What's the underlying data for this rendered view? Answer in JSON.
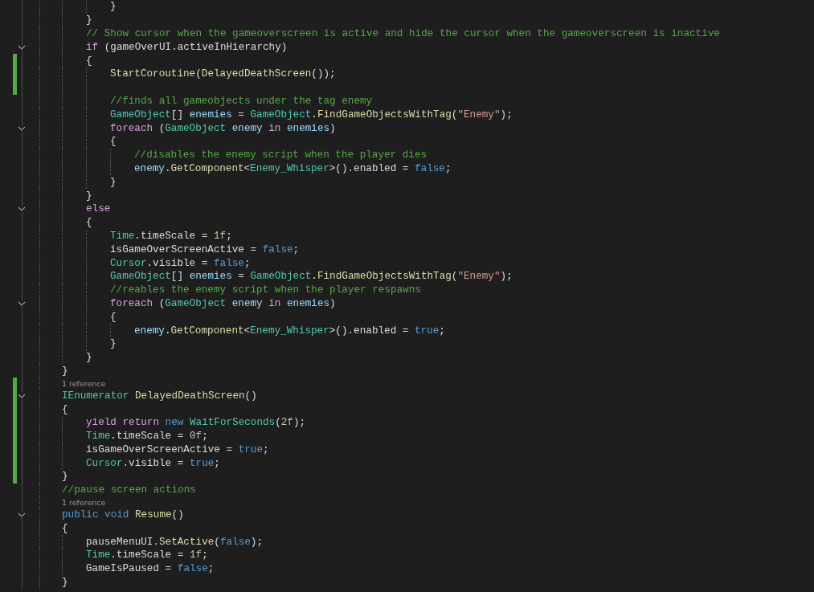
{
  "lines": [
    {
      "children": [
        {
          "children": [
            {
              "kind": "code",
              "tokens": [
                {
                  "text": "}",
                  "kind": "plain"
                }
              ]
            }
          ]
        },
        {
          "kind": "code",
          "tokens": [
            {
              "text": "}",
              "kind": "plain"
            }
          ]
        },
        {
          "kind": "code",
          "tokens": [
            {
              "text": "// Show cursor when the gameoverscreen is active and hide the cursor when the gameoverscreen is inactive",
              "kind": "comment"
            }
          ]
        },
        {
          "kind": "code",
          "foldable": true,
          "tokens": [
            {
              "text": "if",
              "kind": "keyword"
            },
            {
              "text": " (gameOverUI.activeInHierarchy)",
              "kind": "plain"
            }
          ]
        },
        {
          "kind": "code",
          "changed": true,
          "tokens": [
            {
              "text": "{",
              "kind": "plain"
            }
          ],
          "children": [
            {
              "kind": "code",
              "changed": true,
              "tokens": [
                {
                  "text": "StartCoroutine",
                  "kind": "method"
                },
                {
                  "text": "(",
                  "kind": "plain"
                },
                {
                  "text": "DelayedDeathScreen",
                  "kind": "method"
                },
                {
                  "text": "());",
                  "kind": "plain"
                }
              ]
            },
            {
              "kind": "blank",
              "changed": true
            },
            {
              "kind": "code",
              "tokens": [
                {
                  "text": "//finds all gameobjects under the tag enemy",
                  "kind": "comment"
                }
              ]
            },
            {
              "kind": "code",
              "tokens": [
                {
                  "text": "GameObject",
                  "kind": "type"
                },
                {
                  "text": "[] ",
                  "kind": "plain"
                },
                {
                  "text": "enemies",
                  "kind": "variable"
                },
                {
                  "text": " = ",
                  "kind": "plain"
                },
                {
                  "text": "GameObject",
                  "kind": "type"
                },
                {
                  "text": ".",
                  "kind": "plain"
                },
                {
                  "text": "FindGameObjectsWithTag",
                  "kind": "method"
                },
                {
                  "text": "(",
                  "kind": "plain"
                },
                {
                  "text": "\"Enemy\"",
                  "kind": "string"
                },
                {
                  "text": ");",
                  "kind": "plain"
                }
              ]
            },
            {
              "kind": "code",
              "foldable": true,
              "tokens": [
                {
                  "text": "foreach",
                  "kind": "keyword"
                },
                {
                  "text": " (",
                  "kind": "plain"
                },
                {
                  "text": "GameObject",
                  "kind": "type"
                },
                {
                  "text": " enemy ",
                  "kind": "variable"
                },
                {
                  "text": "in",
                  "kind": "keyword"
                },
                {
                  "text": " enemies",
                  "kind": "variable"
                },
                {
                  "text": ")",
                  "kind": "plain"
                }
              ]
            },
            {
              "kind": "code",
              "tokens": [
                {
                  "text": "{",
                  "kind": "plain"
                }
              ],
              "children": [
                {
                  "kind": "code",
                  "tokens": [
                    {
                      "text": "//disables the enemy script when the player dies",
                      "kind": "comment"
                    }
                  ]
                },
                {
                  "kind": "code",
                  "tokens": [
                    {
                      "text": "enemy",
                      "kind": "variable"
                    },
                    {
                      "text": ".",
                      "kind": "plain"
                    },
                    {
                      "text": "GetComponent",
                      "kind": "method"
                    },
                    {
                      "text": "<",
                      "kind": "plain"
                    },
                    {
                      "text": "Enemy_Whisper",
                      "kind": "type"
                    },
                    {
                      "text": ">().enabled = ",
                      "kind": "plain"
                    },
                    {
                      "text": "false",
                      "kind": "literal"
                    },
                    {
                      "text": ";",
                      "kind": "plain"
                    }
                  ]
                }
              ]
            },
            {
              "kind": "code",
              "tokens": [
                {
                  "text": "}",
                  "kind": "plain"
                }
              ]
            }
          ]
        },
        {
          "kind": "code",
          "tokens": [
            {
              "text": "}",
              "kind": "plain"
            }
          ]
        },
        {
          "kind": "code",
          "foldable": true,
          "tokens": [
            {
              "text": "else",
              "kind": "keyword"
            }
          ]
        },
        {
          "kind": "code",
          "tokens": [
            {
              "text": "{",
              "kind": "plain"
            }
          ],
          "children": [
            {
              "kind": "code",
              "tokens": [
                {
                  "text": "Time",
                  "kind": "type"
                },
                {
                  "text": ".timeScale = ",
                  "kind": "plain"
                },
                {
                  "text": "1f",
                  "kind": "number"
                },
                {
                  "text": ";",
                  "kind": "plain"
                }
              ]
            },
            {
              "kind": "code",
              "tokens": [
                {
                  "text": "isGameOverScreenActive = ",
                  "kind": "plain"
                },
                {
                  "text": "false",
                  "kind": "literal"
                },
                {
                  "text": ";",
                  "kind": "plain"
                }
              ]
            },
            {
              "kind": "code",
              "tokens": [
                {
                  "text": "Cursor",
                  "kind": "type"
                },
                {
                  "text": ".visible = ",
                  "kind": "plain"
                },
                {
                  "text": "false",
                  "kind": "literal"
                },
                {
                  "text": ";",
                  "kind": "plain"
                }
              ]
            },
            {
              "kind": "code",
              "tokens": [
                {
                  "text": "GameObject",
                  "kind": "type"
                },
                {
                  "text": "[] ",
                  "kind": "plain"
                },
                {
                  "text": "enemies",
                  "kind": "variable"
                },
                {
                  "text": " = ",
                  "kind": "plain"
                },
                {
                  "text": "GameObject",
                  "kind": "type"
                },
                {
                  "text": ".",
                  "kind": "plain"
                },
                {
                  "text": "FindGameObjectsWithTag",
                  "kind": "method"
                },
                {
                  "text": "(",
                  "kind": "plain"
                },
                {
                  "text": "\"Enemy\"",
                  "kind": "string"
                },
                {
                  "text": ");",
                  "kind": "plain"
                }
              ]
            },
            {
              "kind": "code",
              "tokens": [
                {
                  "text": "//reables the enemy script when the player respawns",
                  "kind": "comment"
                }
              ]
            },
            {
              "kind": "code",
              "foldable": true,
              "tokens": [
                {
                  "text": "foreach",
                  "kind": "keyword"
                },
                {
                  "text": " (",
                  "kind": "plain"
                },
                {
                  "text": "GameObject",
                  "kind": "type"
                },
                {
                  "text": " enemy ",
                  "kind": "variable"
                },
                {
                  "text": "in",
                  "kind": "keyword"
                },
                {
                  "text": " enemies",
                  "kind": "variable"
                },
                {
                  "text": ")",
                  "kind": "plain"
                }
              ]
            },
            {
              "kind": "code",
              "tokens": [
                {
                  "text": "{",
                  "kind": "plain"
                }
              ],
              "children": [
                {
                  "kind": "code",
                  "tokens": [
                    {
                      "text": "enemy",
                      "kind": "variable"
                    },
                    {
                      "text": ".",
                      "kind": "plain"
                    },
                    {
                      "text": "GetComponent",
                      "kind": "method"
                    },
                    {
                      "text": "<",
                      "kind": "plain"
                    },
                    {
                      "text": "Enemy_Whisper",
                      "kind": "type"
                    },
                    {
                      "text": ">().enabled = ",
                      "kind": "plain"
                    },
                    {
                      "text": "true",
                      "kind": "literal"
                    },
                    {
                      "text": ";",
                      "kind": "plain"
                    }
                  ]
                }
              ]
            },
            {
              "kind": "code",
              "tokens": [
                {
                  "text": "}",
                  "kind": "plain"
                }
              ]
            }
          ]
        },
        {
          "kind": "code",
          "tokens": [
            {
              "text": "}",
              "kind": "plain"
            }
          ]
        }
      ]
    },
    {
      "kind": "code",
      "tokens": [
        {
          "text": "}",
          "kind": "plain"
        }
      ]
    },
    {
      "kind": "codelens",
      "changed": true,
      "text": "1 reference"
    },
    {
      "kind": "code",
      "foldable": true,
      "changed": true,
      "tokens": [
        {
          "text": "IEnumerator",
          "kind": "type"
        },
        {
          "text": " DelayedDeathScreen",
          "kind": "method"
        },
        {
          "text": "()",
          "kind": "plain"
        }
      ]
    },
    {
      "kind": "code",
      "changed": true,
      "tokens": [
        {
          "text": "{",
          "kind": "plain"
        }
      ],
      "children": [
        {
          "kind": "code",
          "changed": true,
          "tokens": [
            {
              "text": "yield return",
              "kind": "keyword"
            },
            {
              "text": " new",
              "kind": "literal"
            },
            {
              "text": " WaitForSeconds",
              "kind": "type"
            },
            {
              "text": "(",
              "kind": "plain"
            },
            {
              "text": "2f",
              "kind": "number"
            },
            {
              "text": ");",
              "kind": "plain"
            }
          ]
        },
        {
          "kind": "code",
          "changed": true,
          "tokens": [
            {
              "text": "Time",
              "kind": "type"
            },
            {
              "text": ".timeScale = ",
              "kind": "plain"
            },
            {
              "text": "0f",
              "kind": "number"
            },
            {
              "text": ";",
              "kind": "plain"
            }
          ]
        },
        {
          "kind": "code",
          "changed": true,
          "tokens": [
            {
              "text": "isGameOverScreenActive = ",
              "kind": "plain"
            },
            {
              "text": "true",
              "kind": "literal"
            },
            {
              "text": ";",
              "kind": "plain"
            }
          ]
        },
        {
          "kind": "code",
          "changed": true,
          "tokens": [
            {
              "text": "Cursor",
              "kind": "type"
            },
            {
              "text": ".visible = ",
              "kind": "plain"
            },
            {
              "text": "true",
              "kind": "literal"
            },
            {
              "text": ";",
              "kind": "plain"
            }
          ]
        }
      ]
    },
    {
      "kind": "code",
      "changed": true,
      "tokens": [
        {
          "text": "}",
          "kind": "plain"
        }
      ]
    },
    {
      "kind": "code",
      "tokens": [
        {
          "text": "//pause screen actions",
          "kind": "comment"
        }
      ]
    },
    {
      "kind": "codelens",
      "text": "1 reference"
    },
    {
      "kind": "code",
      "foldable": true,
      "tokens": [
        {
          "text": "public void",
          "kind": "literal"
        },
        {
          "text": " Resume",
          "kind": "method"
        },
        {
          "text": "()",
          "kind": "plain"
        }
      ]
    },
    {
      "kind": "code",
      "tokens": [
        {
          "text": "{",
          "kind": "plain"
        }
      ],
      "children": [
        {
          "kind": "code",
          "tokens": [
            {
              "text": "pauseMenuUI.",
              "kind": "plain"
            },
            {
              "text": "SetActive",
              "kind": "method"
            },
            {
              "text": "(",
              "kind": "plain"
            },
            {
              "text": "false",
              "kind": "literal"
            },
            {
              "text": ");",
              "kind": "plain"
            }
          ]
        },
        {
          "kind": "code",
          "tokens": [
            {
              "text": "Time",
              "kind": "type"
            },
            {
              "text": ".timeScale = ",
              "kind": "plain"
            },
            {
              "text": "1f",
              "kind": "number"
            },
            {
              "text": ";",
              "kind": "plain"
            }
          ]
        },
        {
          "kind": "code",
          "tokens": [
            {
              "text": "GameIsPaused = ",
              "kind": "plain"
            },
            {
              "text": "false",
              "kind": "literal"
            },
            {
              "text": ";",
              "kind": "plain"
            }
          ]
        }
      ]
    },
    {
      "kind": "code",
      "tokens": [
        {
          "text": "}",
          "kind": "plain"
        }
      ]
    }
  ]
}
